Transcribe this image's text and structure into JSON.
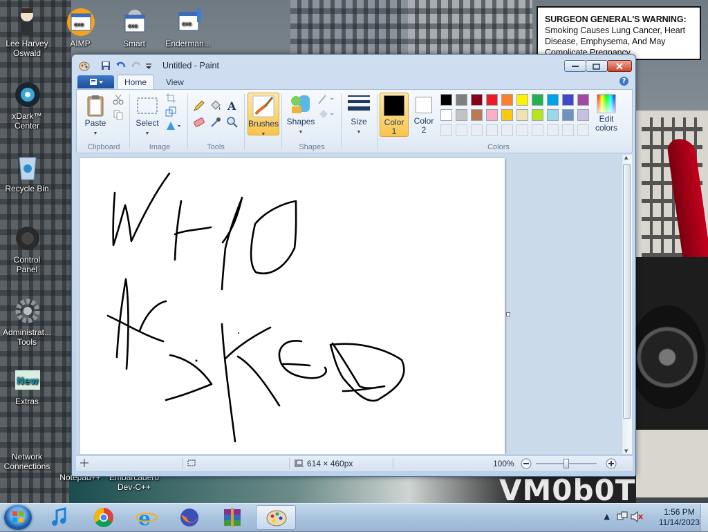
{
  "warning": {
    "heading": "SURGEON GENERAL'S WARNING:",
    "body": "Smoking Causes Lung Cancer, Heart Disease, Emphysema, And May Complicate Pregnancy."
  },
  "desktop": {
    "icons": [
      {
        "label": "Lee Harvey Oswald"
      },
      {
        "label": "AIMP"
      },
      {
        "label": "Smart"
      },
      {
        "label": "Enderman..."
      },
      {
        "label": "xDark™ Center"
      },
      {
        "label": "Recycle Bin"
      },
      {
        "label": "Control Panel"
      },
      {
        "label": "Administrat... Tools"
      },
      {
        "label": "Extras"
      },
      {
        "label": "Network Connections"
      },
      {
        "label": "Notepad++"
      },
      {
        "label": "Embarcadero Dev-C++"
      }
    ],
    "wallpaper_text": "VM0b0T"
  },
  "window": {
    "title": "Untitled - Paint",
    "tabs": [
      "Home",
      "View"
    ],
    "ribbon": {
      "clipboard": {
        "paste": "Paste",
        "label": "Clipboard"
      },
      "image": {
        "select": "Select",
        "label": "Image"
      },
      "tools": {
        "label": "Tools"
      },
      "brushes": "Brushes",
      "shapes": {
        "button": "Shapes",
        "label": "Shapes"
      },
      "size": "Size",
      "color1": "Color 1",
      "color2": "Color 2",
      "edit_colors": "Edit colors",
      "colors_label": "Colors",
      "palette_row1": [
        "#000000",
        "#7f7f7f",
        "#880015",
        "#ed1c24",
        "#ff7f27",
        "#fff200",
        "#22b14c",
        "#00a2e8",
        "#3f48cc",
        "#a349a4"
      ],
      "palette_row2": [
        "#ffffff",
        "#c3c3c3",
        "#b97a57",
        "#ffaec9",
        "#ffc90e",
        "#efe4b0",
        "#b5e61d",
        "#99d9ea",
        "#7092be",
        "#c8bfe7"
      ],
      "color1_value": "#000000",
      "color2_value": "#ffffff"
    },
    "status": {
      "canvas_size": "614 × 460px",
      "zoom": "100%"
    }
  },
  "taskbar": {
    "apps": [
      "itunes",
      "chrome",
      "internet-explorer",
      "firefox",
      "winrar",
      "paint"
    ],
    "time": "1:56 PM",
    "date": "11/14/2023"
  }
}
